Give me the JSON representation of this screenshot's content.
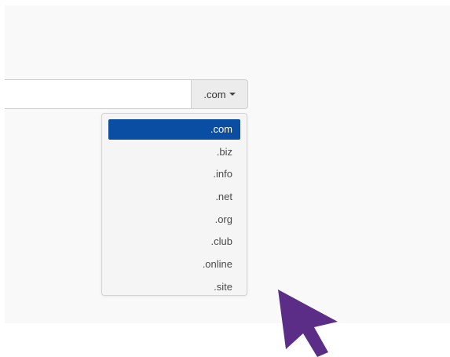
{
  "domain_search": {
    "input_value": "",
    "tld_selected": ".com"
  },
  "tld_menu": {
    "items": [
      ".com",
      ".biz",
      ".info",
      ".net",
      ".org",
      ".club",
      ".online",
      ".site"
    ],
    "active_index": 0
  },
  "colors": {
    "highlight": "#0a4ea3",
    "cursor": "#5b2d86",
    "panel_bg": "#f9f9f9"
  },
  "icons": {
    "caret": "caret-down-icon",
    "pointer": "mouse-pointer-icon"
  }
}
